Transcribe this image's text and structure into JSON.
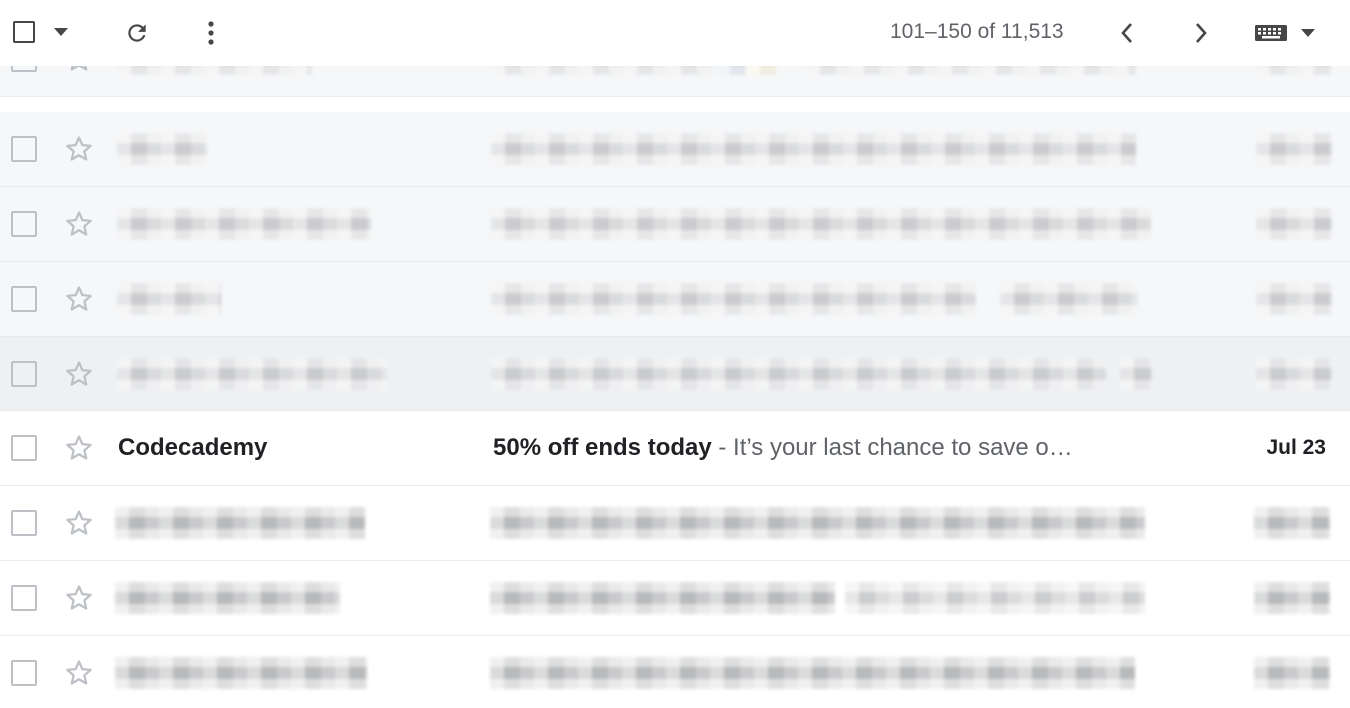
{
  "toolbar": {
    "select_icon": "checkbox-outline-icon",
    "select_menu_icon": "caret-down-icon",
    "refresh_icon": "refresh-icon",
    "more_icon": "more-vert-icon",
    "pagination": "101–150 of 11,513",
    "prev_icon": "chevron-left-icon",
    "next_icon": "chevron-right-icon",
    "input_tools_icon": "keyboard-icon",
    "input_tools_menu_icon": "caret-down-icon"
  },
  "messages": [
    {
      "state": "read",
      "redacted": true
    },
    {
      "state": "read",
      "redacted": true
    },
    {
      "state": "read",
      "redacted": true
    },
    {
      "state": "read",
      "redacted": true
    },
    {
      "state": "read",
      "redacted": true
    },
    {
      "state": "unread",
      "redacted": false,
      "sender": "Codecademy",
      "subject": "50% off ends today",
      "separator": " - ",
      "snippet": "It’s your last chance to save o…",
      "date": "Jul 23"
    },
    {
      "state": "unread",
      "redacted": true
    },
    {
      "state": "unread",
      "redacted": true
    },
    {
      "state": "unread",
      "redacted": true
    }
  ],
  "colors": {
    "read_row_bg": "#f5f7f9",
    "unread_row_bg": "#ffffff",
    "hover_row_bg": "#eef1f4",
    "icon": "#444746",
    "muted_text": "#5f6368",
    "primary_text": "#202124"
  }
}
